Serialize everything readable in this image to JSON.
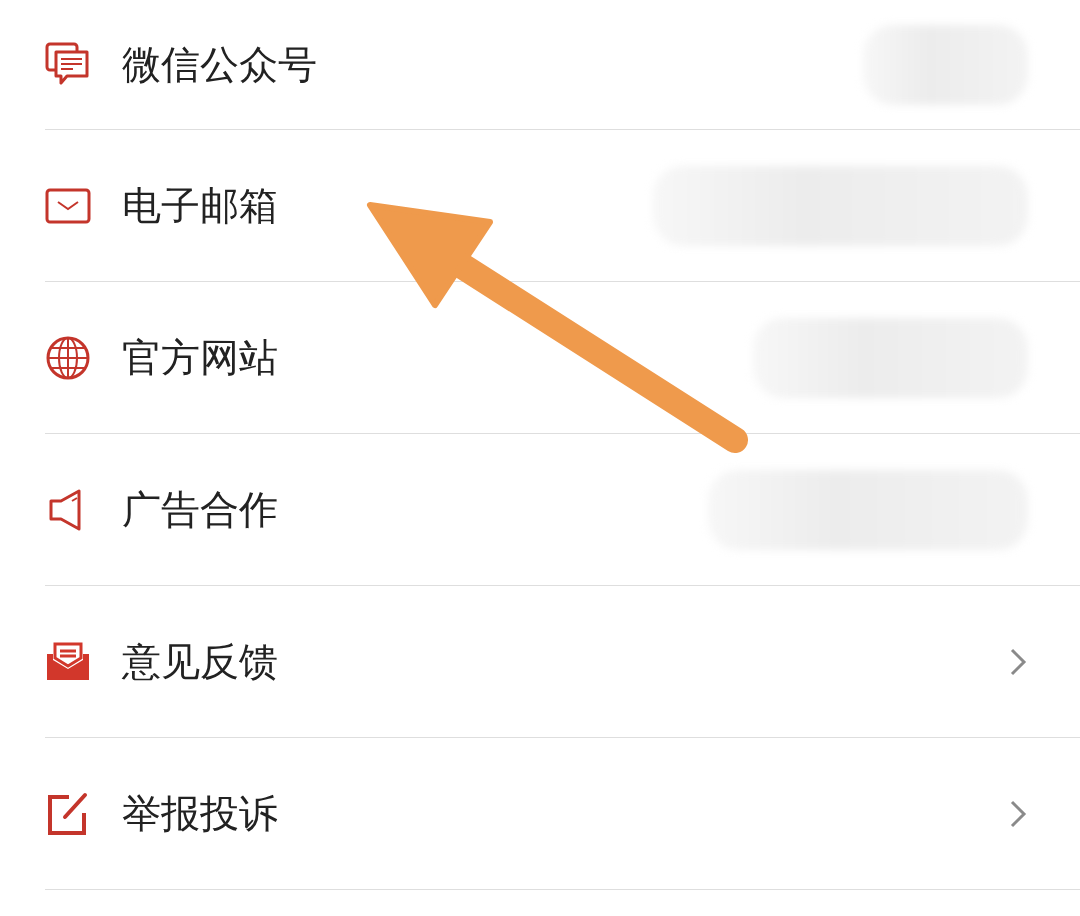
{
  "rows": [
    {
      "label": "微信公众号",
      "kind": "chat",
      "chevron": false
    },
    {
      "label": "电子邮箱",
      "kind": "mail",
      "chevron": false
    },
    {
      "label": "官方网站",
      "kind": "globe",
      "chevron": false
    },
    {
      "label": "广告合作",
      "kind": "speaker",
      "chevron": false
    },
    {
      "label": "意见反馈",
      "kind": "feedback",
      "chevron": true
    },
    {
      "label": "举报投诉",
      "kind": "report",
      "chevron": true
    }
  ],
  "annotation": {
    "kind": "arrow"
  }
}
